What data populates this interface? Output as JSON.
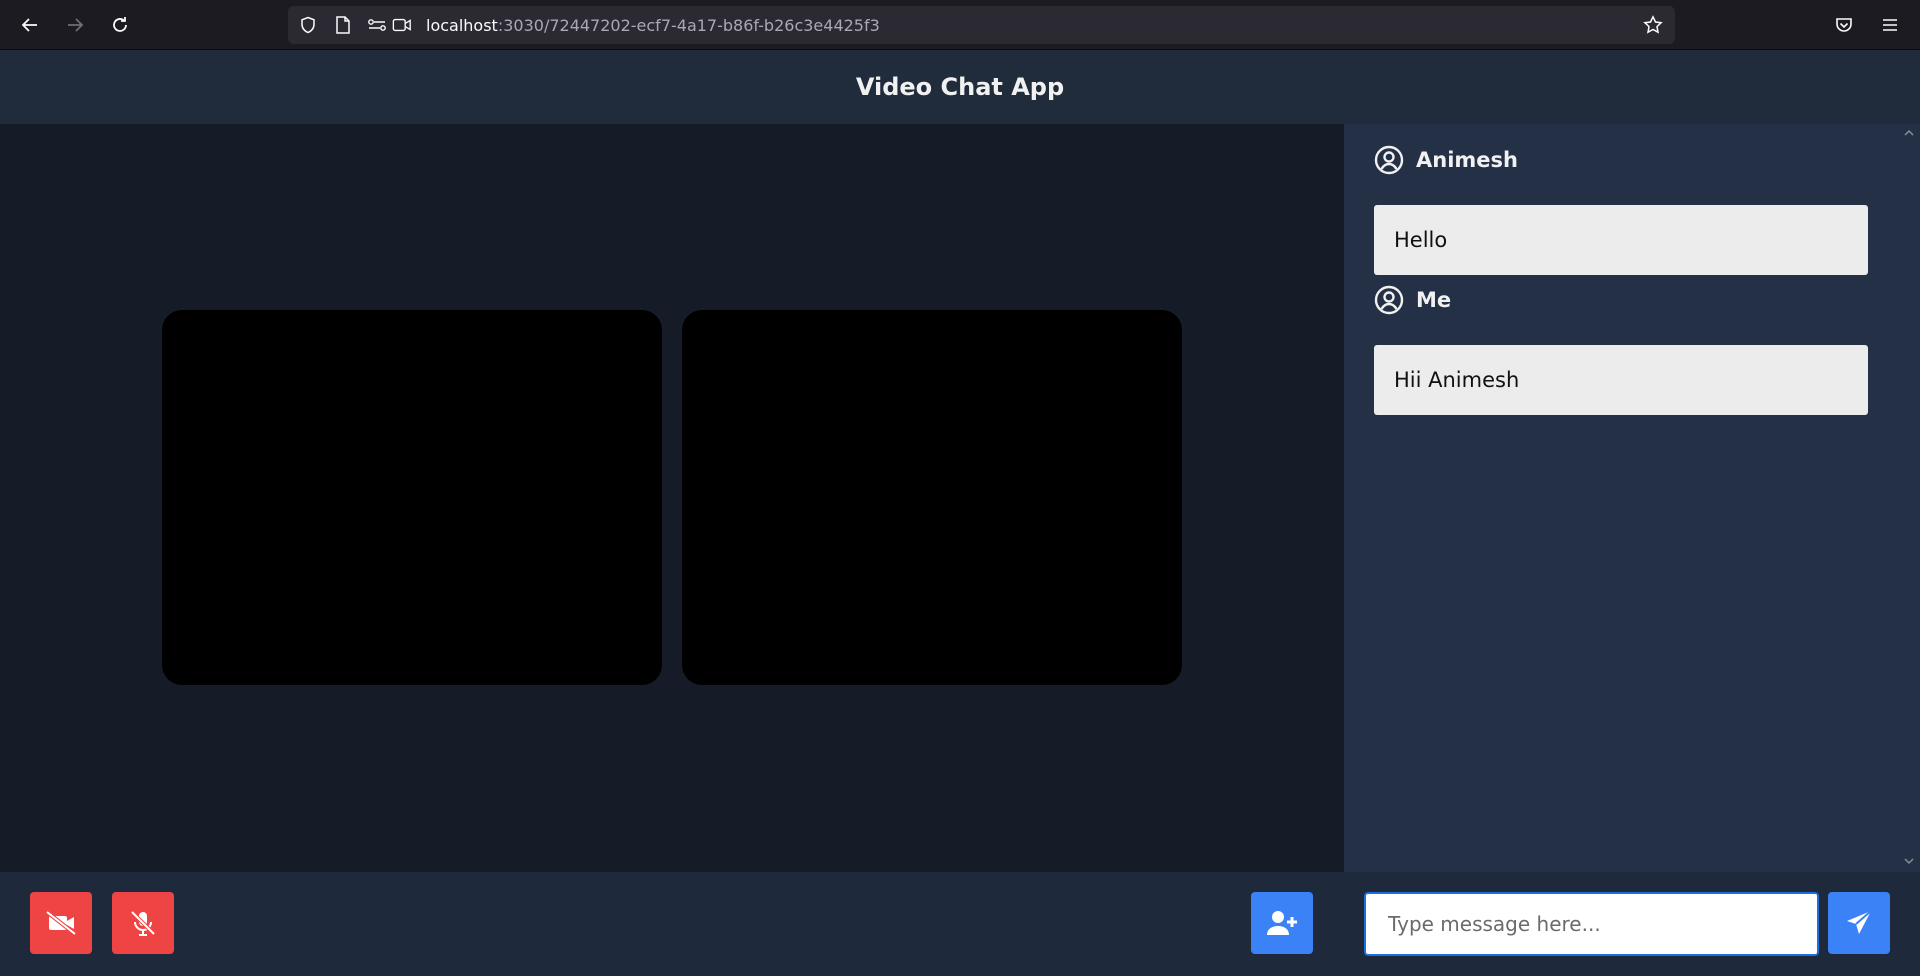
{
  "browser": {
    "url_host": "localhost",
    "url_path": ":3030/72447202-ecf7-4a17-b86f-b26c3e4425f3",
    "icons": [
      "back-arrow-icon",
      "forward-arrow-icon",
      "reload-icon",
      "shield-icon",
      "page-icon",
      "permissions-icon",
      "camera-permission-icon",
      "bookmark-star-icon",
      "pocket-icon",
      "menu-icon"
    ]
  },
  "app": {
    "title": "Video Chat App"
  },
  "chat": {
    "messages": [
      {
        "author": "Animesh",
        "text": "Hello"
      },
      {
        "author": "Me",
        "text": "Hii Animesh"
      }
    ],
    "input_placeholder": "Type message here..."
  },
  "controls": {
    "video_toggle": "video-off-icon",
    "mic_toggle": "mic-off-icon",
    "add_user": "user-plus-icon",
    "send": "send-icon"
  },
  "colors": {
    "danger": "#ef4444",
    "primary": "#3b82f6",
    "chat_bg": "#243045",
    "video_bg": "#161c27"
  }
}
